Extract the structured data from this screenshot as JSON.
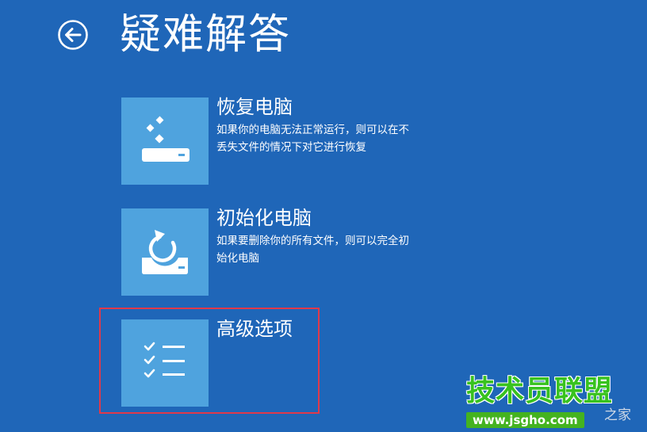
{
  "header": {
    "title": "疑难解答",
    "back_icon": "back-arrow-icon"
  },
  "options": [
    {
      "title": "恢复电脑",
      "description": "如果你的电脑无法正常运行，则可以在不丢失文件的情况下对它进行恢复",
      "icon": "refresh-pc-icon"
    },
    {
      "title": "初始化电脑",
      "description": "如果要删除你的所有文件，则可以完全初始化电脑",
      "icon": "reset-pc-icon"
    },
    {
      "title": "高级选项",
      "description": "",
      "icon": "checklist-icon",
      "highlighted": true
    }
  ],
  "watermark": {
    "logo": "技术员联盟",
    "url": "www.jsgho.com",
    "suffix": "之家"
  },
  "colors": {
    "background": "#1f66b8",
    "tile": "#4fa3de",
    "highlight_border": "#e0394a",
    "watermark_green": "#38c21f"
  }
}
